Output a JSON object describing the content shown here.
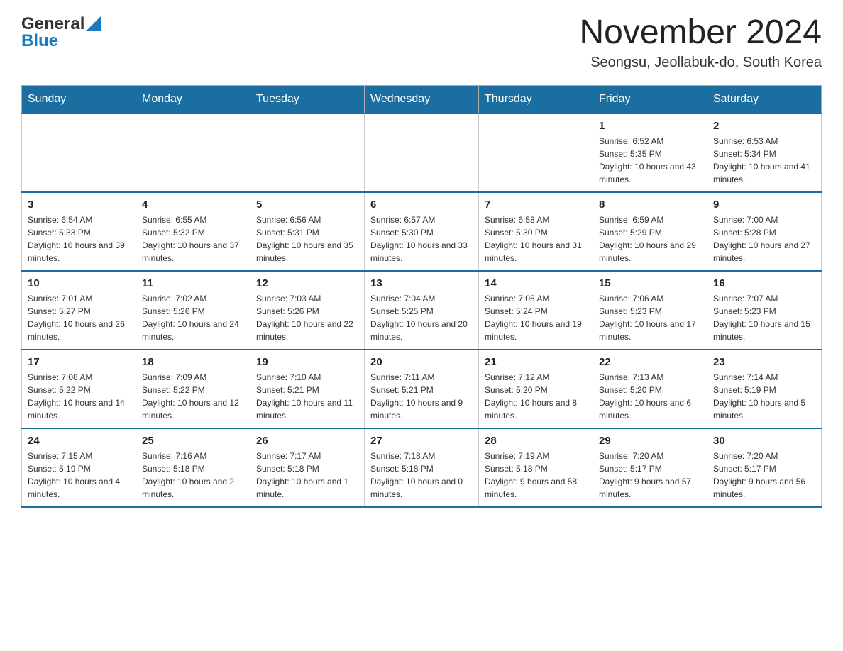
{
  "header": {
    "logo_general": "General",
    "logo_blue": "Blue",
    "month_title": "November 2024",
    "location": "Seongsu, Jeollabuk-do, South Korea"
  },
  "weekdays": [
    "Sunday",
    "Monday",
    "Tuesday",
    "Wednesday",
    "Thursday",
    "Friday",
    "Saturday"
  ],
  "weeks": [
    [
      {
        "day": "",
        "info": ""
      },
      {
        "day": "",
        "info": ""
      },
      {
        "day": "",
        "info": ""
      },
      {
        "day": "",
        "info": ""
      },
      {
        "day": "",
        "info": ""
      },
      {
        "day": "1",
        "info": "Sunrise: 6:52 AM\nSunset: 5:35 PM\nDaylight: 10 hours and 43 minutes."
      },
      {
        "day": "2",
        "info": "Sunrise: 6:53 AM\nSunset: 5:34 PM\nDaylight: 10 hours and 41 minutes."
      }
    ],
    [
      {
        "day": "3",
        "info": "Sunrise: 6:54 AM\nSunset: 5:33 PM\nDaylight: 10 hours and 39 minutes."
      },
      {
        "day": "4",
        "info": "Sunrise: 6:55 AM\nSunset: 5:32 PM\nDaylight: 10 hours and 37 minutes."
      },
      {
        "day": "5",
        "info": "Sunrise: 6:56 AM\nSunset: 5:31 PM\nDaylight: 10 hours and 35 minutes."
      },
      {
        "day": "6",
        "info": "Sunrise: 6:57 AM\nSunset: 5:30 PM\nDaylight: 10 hours and 33 minutes."
      },
      {
        "day": "7",
        "info": "Sunrise: 6:58 AM\nSunset: 5:30 PM\nDaylight: 10 hours and 31 minutes."
      },
      {
        "day": "8",
        "info": "Sunrise: 6:59 AM\nSunset: 5:29 PM\nDaylight: 10 hours and 29 minutes."
      },
      {
        "day": "9",
        "info": "Sunrise: 7:00 AM\nSunset: 5:28 PM\nDaylight: 10 hours and 27 minutes."
      }
    ],
    [
      {
        "day": "10",
        "info": "Sunrise: 7:01 AM\nSunset: 5:27 PM\nDaylight: 10 hours and 26 minutes."
      },
      {
        "day": "11",
        "info": "Sunrise: 7:02 AM\nSunset: 5:26 PM\nDaylight: 10 hours and 24 minutes."
      },
      {
        "day": "12",
        "info": "Sunrise: 7:03 AM\nSunset: 5:26 PM\nDaylight: 10 hours and 22 minutes."
      },
      {
        "day": "13",
        "info": "Sunrise: 7:04 AM\nSunset: 5:25 PM\nDaylight: 10 hours and 20 minutes."
      },
      {
        "day": "14",
        "info": "Sunrise: 7:05 AM\nSunset: 5:24 PM\nDaylight: 10 hours and 19 minutes."
      },
      {
        "day": "15",
        "info": "Sunrise: 7:06 AM\nSunset: 5:23 PM\nDaylight: 10 hours and 17 minutes."
      },
      {
        "day": "16",
        "info": "Sunrise: 7:07 AM\nSunset: 5:23 PM\nDaylight: 10 hours and 15 minutes."
      }
    ],
    [
      {
        "day": "17",
        "info": "Sunrise: 7:08 AM\nSunset: 5:22 PM\nDaylight: 10 hours and 14 minutes."
      },
      {
        "day": "18",
        "info": "Sunrise: 7:09 AM\nSunset: 5:22 PM\nDaylight: 10 hours and 12 minutes."
      },
      {
        "day": "19",
        "info": "Sunrise: 7:10 AM\nSunset: 5:21 PM\nDaylight: 10 hours and 11 minutes."
      },
      {
        "day": "20",
        "info": "Sunrise: 7:11 AM\nSunset: 5:21 PM\nDaylight: 10 hours and 9 minutes."
      },
      {
        "day": "21",
        "info": "Sunrise: 7:12 AM\nSunset: 5:20 PM\nDaylight: 10 hours and 8 minutes."
      },
      {
        "day": "22",
        "info": "Sunrise: 7:13 AM\nSunset: 5:20 PM\nDaylight: 10 hours and 6 minutes."
      },
      {
        "day": "23",
        "info": "Sunrise: 7:14 AM\nSunset: 5:19 PM\nDaylight: 10 hours and 5 minutes."
      }
    ],
    [
      {
        "day": "24",
        "info": "Sunrise: 7:15 AM\nSunset: 5:19 PM\nDaylight: 10 hours and 4 minutes."
      },
      {
        "day": "25",
        "info": "Sunrise: 7:16 AM\nSunset: 5:18 PM\nDaylight: 10 hours and 2 minutes."
      },
      {
        "day": "26",
        "info": "Sunrise: 7:17 AM\nSunset: 5:18 PM\nDaylight: 10 hours and 1 minute."
      },
      {
        "day": "27",
        "info": "Sunrise: 7:18 AM\nSunset: 5:18 PM\nDaylight: 10 hours and 0 minutes."
      },
      {
        "day": "28",
        "info": "Sunrise: 7:19 AM\nSunset: 5:18 PM\nDaylight: 9 hours and 58 minutes."
      },
      {
        "day": "29",
        "info": "Sunrise: 7:20 AM\nSunset: 5:17 PM\nDaylight: 9 hours and 57 minutes."
      },
      {
        "day": "30",
        "info": "Sunrise: 7:20 AM\nSunset: 5:17 PM\nDaylight: 9 hours and 56 minutes."
      }
    ]
  ]
}
